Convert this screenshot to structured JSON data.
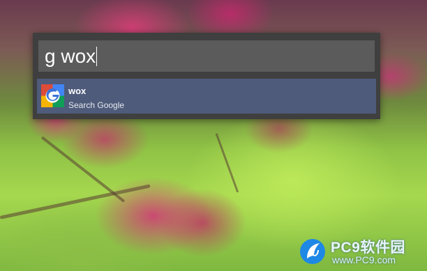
{
  "launcher": {
    "query": "g wox",
    "results": [
      {
        "title": "wox",
        "subtitle": "Search Google",
        "icon": "google-icon"
      }
    ]
  },
  "watermark": {
    "title": "PC9软件园",
    "url": "www.PC9.com",
    "logo": "pc9-logo-icon"
  },
  "colors": {
    "panel_bg": "#3f3f3f",
    "query_bg": "#5b5b5b",
    "selected_result_bg": "#4e5b7b",
    "text": "#ffffff"
  }
}
